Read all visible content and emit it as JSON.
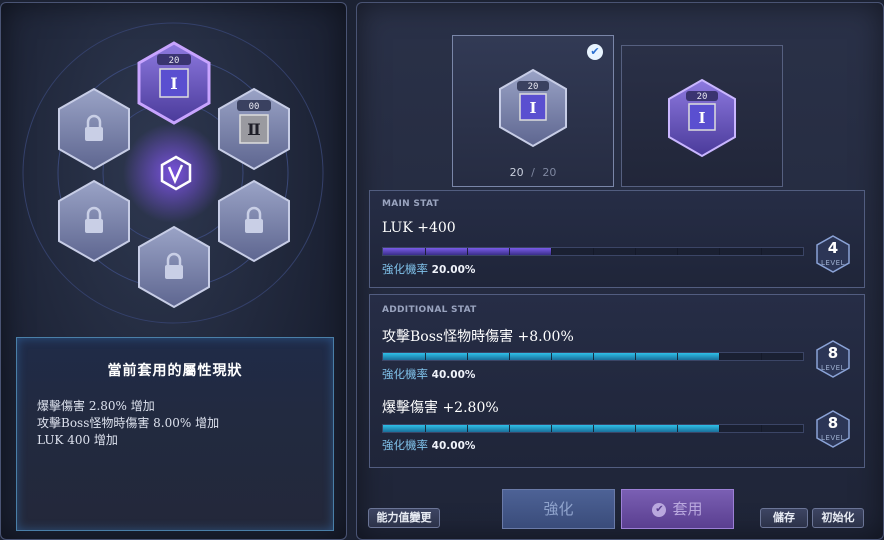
{
  "slots": [
    {
      "id": "top",
      "number": "20",
      "state": "equipped-selected"
    },
    {
      "id": "top-right",
      "number": "00",
      "state": "unlocked"
    },
    {
      "id": "top-left",
      "state": "locked"
    },
    {
      "id": "bottom-left",
      "state": "locked"
    },
    {
      "id": "bottom-right",
      "state": "locked"
    },
    {
      "id": "bottom",
      "state": "locked"
    }
  ],
  "center_emblem_icon": "v-emblem-icon",
  "info": {
    "title": "當前套用的屬性現狀",
    "lines": [
      "爆擊傷害 2.80% 增加",
      "攻擊Boss怪物時傷害 8.00% 增加",
      "LUK 400 增加"
    ]
  },
  "cards": {
    "current": {
      "badge": "20",
      "level_current": "20",
      "separator": "/",
      "level_max": "20",
      "checked": true
    },
    "next": {
      "badge": "20"
    }
  },
  "main_stat": {
    "header": "MAIN STAT",
    "name": "LUK +400",
    "rate_label": "強化機率",
    "rate_value": "20.00%",
    "progress": 0.4,
    "level": "4",
    "level_label": "LEVEL"
  },
  "additional_stat": {
    "header": "ADDITIONAL STAT",
    "items": [
      {
        "name": "攻擊Boss怪物時傷害 +8.00%",
        "rate_label": "強化機率",
        "rate_value": "40.00%",
        "progress": 0.8,
        "level": "8",
        "level_label": "LEVEL"
      },
      {
        "name": "爆擊傷害 +2.80%",
        "rate_label": "強化機率",
        "rate_value": "40.00%",
        "progress": 0.8,
        "level": "8",
        "level_label": "LEVEL"
      }
    ]
  },
  "buttons": {
    "enhance": "強化",
    "apply": "套用",
    "ability": "能力值變更",
    "save": "儲存",
    "reset": "初始化"
  },
  "colors": {
    "main_bar": "#7a5be8",
    "additional_bar": "#2ec0e8",
    "selected_glow": "#9b6cff"
  }
}
